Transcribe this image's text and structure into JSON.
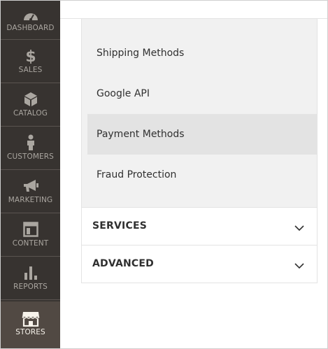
{
  "sidebar": {
    "items": [
      {
        "label": "DASHBOARD",
        "icon": "dashboard-icon"
      },
      {
        "label": "SALES",
        "icon": "dollar-icon"
      },
      {
        "label": "CATALOG",
        "icon": "box-icon"
      },
      {
        "label": "CUSTOMERS",
        "icon": "person-icon"
      },
      {
        "label": "MARKETING",
        "icon": "megaphone-icon"
      },
      {
        "label": "CONTENT",
        "icon": "layout-icon"
      },
      {
        "label": "REPORTS",
        "icon": "bar-chart-icon"
      },
      {
        "label": "STORES",
        "icon": "storefront-icon",
        "active": true
      }
    ]
  },
  "config_nav": {
    "subitems": [
      {
        "label": "Shipping Methods"
      },
      {
        "label": "Google API"
      },
      {
        "label": "Payment Methods",
        "active": true
      },
      {
        "label": "Fraud Protection"
      }
    ],
    "sections": [
      {
        "label": "SERVICES",
        "icon": "chevron-down-icon"
      },
      {
        "label": "ADVANCED",
        "icon": "chevron-down-icon"
      }
    ]
  },
  "colors": {
    "sidebar_bg": "#373330",
    "sidebar_active_bg": "#514943",
    "sidebar_text": "#aaa6a0",
    "submenu_bg": "#f1f1f1",
    "submenu_active_bg": "#e3e3e3",
    "text": "#303030"
  }
}
